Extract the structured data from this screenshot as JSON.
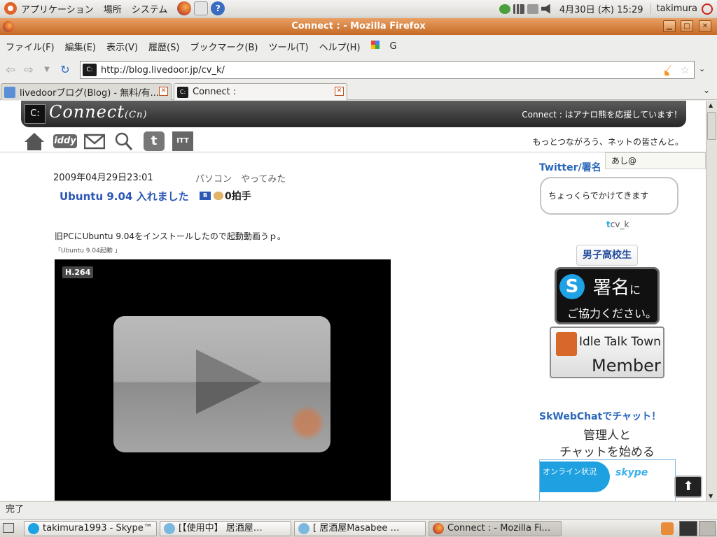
{
  "top_panel": {
    "menus": [
      "アプリケーション",
      "場所",
      "システム"
    ],
    "clock": "4月30日 (木) 15:29",
    "user": "takimura"
  },
  "window": {
    "title": "Connect : - Mozilla Firefox"
  },
  "menubar": [
    "ファイル(F)",
    "編集(E)",
    "表示(V)",
    "履歴(S)",
    "ブックマーク(B)",
    "ツール(T)",
    "ヘルプ(H)",
    "G"
  ],
  "navbar": {
    "url": "http://blog.livedoor.jp/cv_k/"
  },
  "tabs": [
    {
      "label": "livedoorブログ(Blog) - 無料/有...",
      "active": false
    },
    {
      "label": "Connect :",
      "active": true
    }
  ],
  "page": {
    "header_logo": "C:",
    "header_name": "Connect",
    "header_name_sub": "(Cn)",
    "header_tagline": "Connect : はアナロ熊を応援しています！",
    "nav_icons": [
      "home-icon",
      "iddy-icon",
      "mail-icon",
      "search-icon",
      "twitter-icon",
      "itt-icon"
    ],
    "iddy_label": "iddy",
    "tagline": "もっとつながろう、ネットの皆さんと。",
    "tooltip": "あし@",
    "post": {
      "date": "2009年04月29日23:01",
      "category": "パソコン　やってみた",
      "title": "Ubuntu 9.04 入れました",
      "clap_count": "0拍手",
      "body": "旧PCにUbuntu 9.04をインストールしたので起動動画うｐ。",
      "video_caption": "「Ubuntu 9.04起動 」",
      "video_badge": "H.264"
    },
    "sidebar": {
      "twitter_heading": "Twitter/署名",
      "tweet": "ちょっくらでかけてきます",
      "twitter_user": "cv_k",
      "dk_badge": "男子高校生",
      "skype_line1": "署名",
      "skype_line1_suffix": "に",
      "skype_line2": "ご協力ください。",
      "itt_line1": "Idle Talk Town",
      "itt_line2": "Member",
      "skweb_heading": "SkWebChatでチャット！",
      "skweb_line1": "管理人と",
      "skweb_line2": "チャットを始める",
      "skchat_status": "オンライン状況",
      "skchat_brand": "skype"
    }
  },
  "statusbar": {
    "text": "完了"
  },
  "taskbar": [
    {
      "label": "takimura1993 - Skype™",
      "active": false
    },
    {
      "label": "[【使用中】 居酒屋…",
      "active": false
    },
    {
      "label": "[ 居酒屋Masabee …",
      "active": false
    },
    {
      "label": "Connect : - Mozilla Fi…",
      "active": true
    }
  ],
  "colors": {
    "titlebar": "#c56a24",
    "link_blue": "#2a56b5",
    "sidebar_heading": "#2a67b9",
    "skype_blue": "#1ea2e4"
  }
}
